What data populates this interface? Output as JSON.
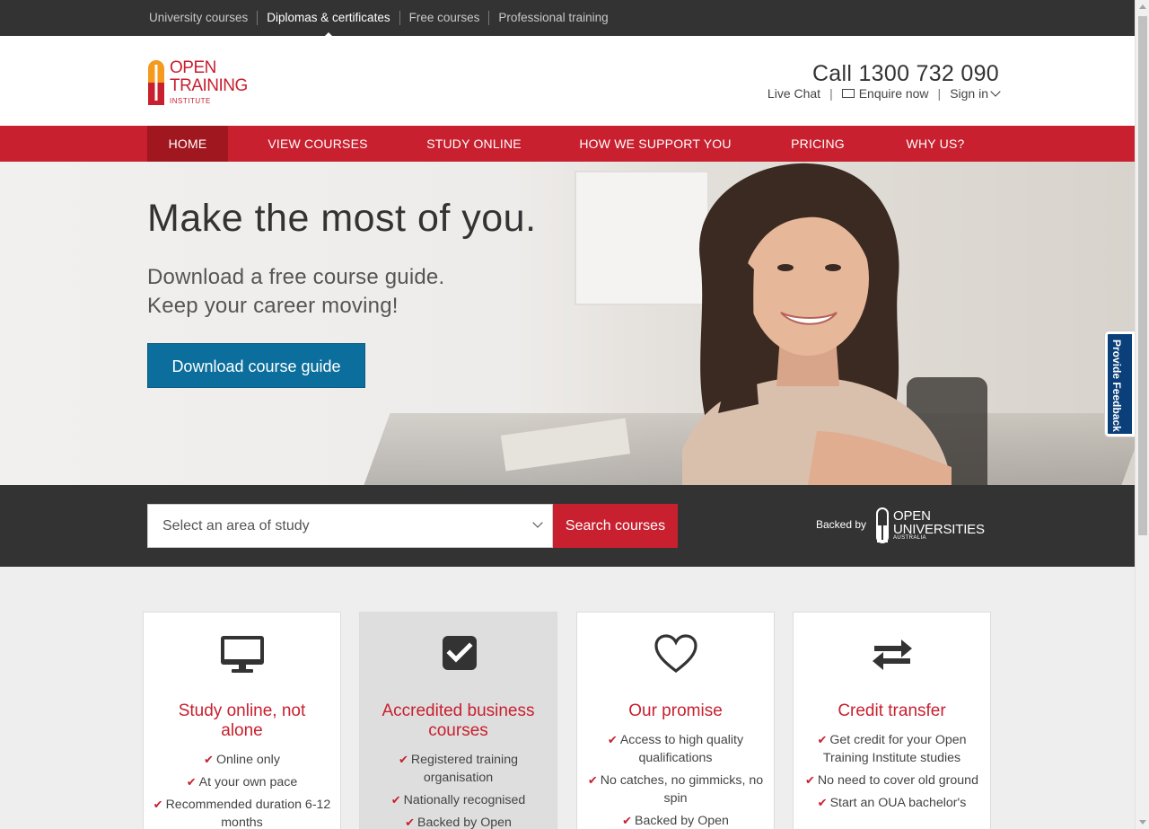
{
  "topbar": {
    "links": [
      {
        "label": "University courses",
        "active": false
      },
      {
        "label": "Diplomas & certificates",
        "active": true
      },
      {
        "label": "Free courses",
        "active": false
      },
      {
        "label": "Professional training",
        "active": false
      }
    ]
  },
  "header": {
    "logo": {
      "line1": "OPEN",
      "line2": "TRAINING",
      "sub": "INSTITUTE"
    },
    "call": "Call 1300 732 090",
    "live_chat": "Live Chat",
    "enquire": "Enquire now",
    "sign_in": "Sign in"
  },
  "nav": {
    "items": [
      "HOME",
      "VIEW COURSES",
      "STUDY ONLINE",
      "HOW WE SUPPORT YOU",
      "PRICING",
      "WHY US?"
    ],
    "active_index": 0
  },
  "hero": {
    "title": "Make the most of you.",
    "subtitle_line1": "Download a free course guide.",
    "subtitle_line2": "Keep your career moving!",
    "button": "Download course guide"
  },
  "search": {
    "select_value": "Select an area of study",
    "button": "Search courses",
    "backed_by": "Backed by",
    "oua": {
      "line1": "OPEN",
      "line2": "UNIVERSITIES",
      "sub": "AUSTRALIA"
    }
  },
  "cards": [
    {
      "icon": "monitor-icon",
      "title": "Study online, not alone",
      "items": [
        "Online only",
        "At your own pace",
        "Recommended duration 6-12 months"
      ]
    },
    {
      "icon": "checkbox-icon",
      "title": "Accredited business courses",
      "items": [
        "Registered training organisation",
        "Nationally recognised",
        "Backed by Open"
      ]
    },
    {
      "icon": "heart-icon",
      "title": "Our promise",
      "items": [
        "Access to high quality qualifications",
        "No catches, no gimmicks, no spin",
        "Backed by Open"
      ]
    },
    {
      "icon": "transfer-arrows-icon",
      "title": "Credit transfer",
      "items": [
        "Get credit for your Open Training Institute studies",
        "No need to cover old ground",
        "Start an OUA bachelor's"
      ]
    }
  ],
  "feedback": "Provide Feedback",
  "colors": {
    "brand_red": "#c8202f",
    "nav_active": "#a0171f",
    "button_blue": "#0b6e9c",
    "dark_bar": "#333333",
    "feedback_blue": "#0b3f7a"
  }
}
